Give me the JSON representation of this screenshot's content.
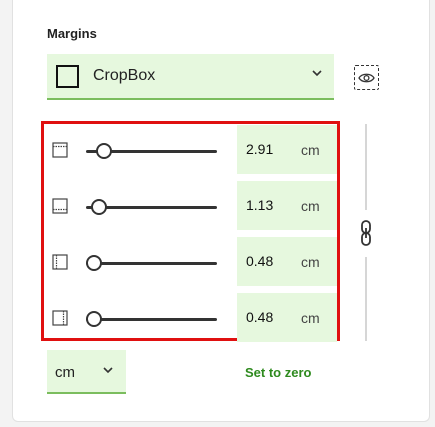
{
  "section": {
    "title": "Margins"
  },
  "box_select": {
    "selected": "CropBox"
  },
  "margins": [
    {
      "edge": "top",
      "icon": "top-margin-icon",
      "slider_fraction": 0.09,
      "value": "2.91",
      "unit": "cm"
    },
    {
      "edge": "bottom",
      "icon": "bottom-margin-icon",
      "slider_fraction": 0.04,
      "value": "1.13",
      "unit": "cm"
    },
    {
      "edge": "left",
      "icon": "left-margin-icon",
      "slider_fraction": 0.0,
      "value": "0.48",
      "unit": "cm"
    },
    {
      "edge": "right",
      "icon": "right-margin-icon",
      "slider_fraction": 0.0,
      "value": "0.48",
      "unit": "cm"
    }
  ],
  "unit_select": {
    "selected": "cm"
  },
  "actions": {
    "set_to_zero": "Set to zero"
  },
  "colors": {
    "accent_green": "#2e8a1e",
    "field_bg": "#e6f8de",
    "highlight_red": "#e01010"
  }
}
